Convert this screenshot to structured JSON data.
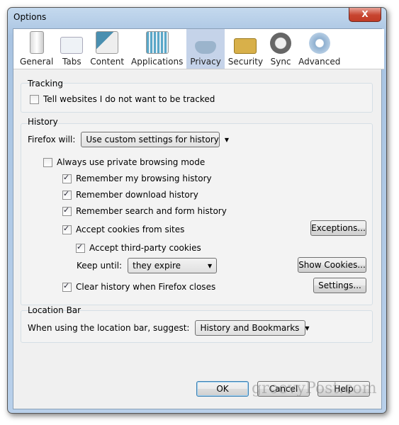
{
  "window": {
    "title": "Options",
    "close": "X"
  },
  "tabs": [
    {
      "label": "General",
      "icon": "switch-icon"
    },
    {
      "label": "Tabs",
      "icon": "folder-tab-icon"
    },
    {
      "label": "Content",
      "icon": "content-icon"
    },
    {
      "label": "Applications",
      "icon": "applications-icon"
    },
    {
      "label": "Privacy",
      "icon": "mask-icon",
      "selected": true
    },
    {
      "label": "Security",
      "icon": "padlock-icon"
    },
    {
      "label": "Sync",
      "icon": "sync-icon"
    },
    {
      "label": "Advanced",
      "icon": "gear-icon"
    }
  ],
  "tracking": {
    "title": "Tracking",
    "dnt": {
      "label": "Tell websites I do not want to be tracked",
      "checked": false
    }
  },
  "history": {
    "title": "History",
    "firefox_will_label": "Firefox will:",
    "firefox_will_value": "Use custom settings for history",
    "private": {
      "label": "Always use private browsing mode",
      "checked": false
    },
    "browsing": {
      "label": "Remember my browsing history",
      "checked": true
    },
    "download": {
      "label": "Remember download history",
      "checked": true
    },
    "search": {
      "label": "Remember search and form history",
      "checked": true
    },
    "cookies": {
      "label": "Accept cookies from sites",
      "checked": true
    },
    "third_party": {
      "label": "Accept third-party cookies",
      "checked": true
    },
    "keep_until_label": "Keep until:",
    "keep_until_value": "they expire",
    "clear": {
      "label": "Clear history when Firefox closes",
      "checked": true
    },
    "exceptions": "Exceptions...",
    "show_cookies": "Show Cookies...",
    "settings": "Settings..."
  },
  "location": {
    "title": "Location Bar",
    "suggest_label": "When using the location bar, suggest:",
    "suggest_value": "History and Bookmarks"
  },
  "buttons": {
    "ok": "OK",
    "cancel": "Cancel",
    "help": "Help"
  },
  "watermark": "groovyPost.com"
}
